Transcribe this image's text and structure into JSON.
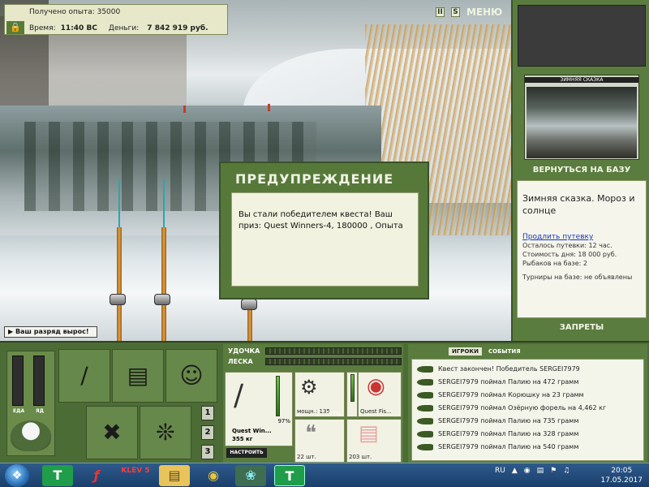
{
  "info_panel": {
    "experience_label": "Получено опыта: 35000",
    "time_label": "Время:",
    "time_value": "11:40 ВС",
    "money_label": "Деньги:",
    "money_value": "7 842 919 руб."
  },
  "top_icons": {
    "pause": "II",
    "sound": "S",
    "menu": "МЕНЮ"
  },
  "rank_notice": "Ваш разряд вырос!",
  "dialog": {
    "title": "ПРЕДУПРЕЖДЕНИЕ",
    "message": "Вы стали победителем квеста! Ваш приз: Quest Winners-4, 180000 , Опыта"
  },
  "right_panel": {
    "postcard_caption": "ЗИМНЯЯ СКАЗКА",
    "back_button": "ВЕРНУТЬСЯ НА БАЗУ",
    "base_name": "Зимняя сказка. Мороз и солнце",
    "extend_link": "Продлить путевку",
    "remaining": "Осталось путевки: 12 час.",
    "day_cost": "Стоимость дня: 18 000 руб.",
    "anglers": "Рыбаков на базе: 2",
    "tournaments": "Турниры на базе: не объявлены",
    "bans_button": "ЗАПРЕТЫ"
  },
  "gauges": {
    "food_label": "ЕДА",
    "poison_label": "ЯД"
  },
  "page_buttons": [
    "1",
    "2",
    "3"
  ],
  "tackle": {
    "rod_label": "УДОЧКА",
    "line_label": "ЛЕСКА",
    "rod_name": "Quest Win...",
    "rod_weight": "355 кг",
    "rod_pct": "97%",
    "reel_power": "мощн.: 135",
    "reel_pct": "97%",
    "line_name": "Quest Fis...",
    "hooks_count": "22 шт.",
    "bait_count": "203 шт.",
    "tune_button": "НАСТРОИТЬ"
  },
  "log": {
    "tab_players": "ИГРОКИ",
    "tab_events": "СОБЫТИЯ",
    "lines": [
      "Квест закончен! Победитель SERGEI7979",
      "SERGEI7979 поймал Палию на 472 грамм",
      "SERGEI7979 поймал Корюшку на 23 грамм",
      "SERGEI7979 поймал Озёрную форель на 4,462 кг",
      "SERGEI7979 поймал Палию на 735 грамм",
      "SERGEI7979 поймал Палию на 328 грамм",
      "SERGEI7979 поймал Палию на 540 грамм"
    ]
  },
  "taskbar": {
    "lang": "RU",
    "time": "20:05",
    "date": "17.05.2017",
    "app_t1": "T",
    "app_klev": "KLEV 5",
    "app_t2": "T"
  }
}
